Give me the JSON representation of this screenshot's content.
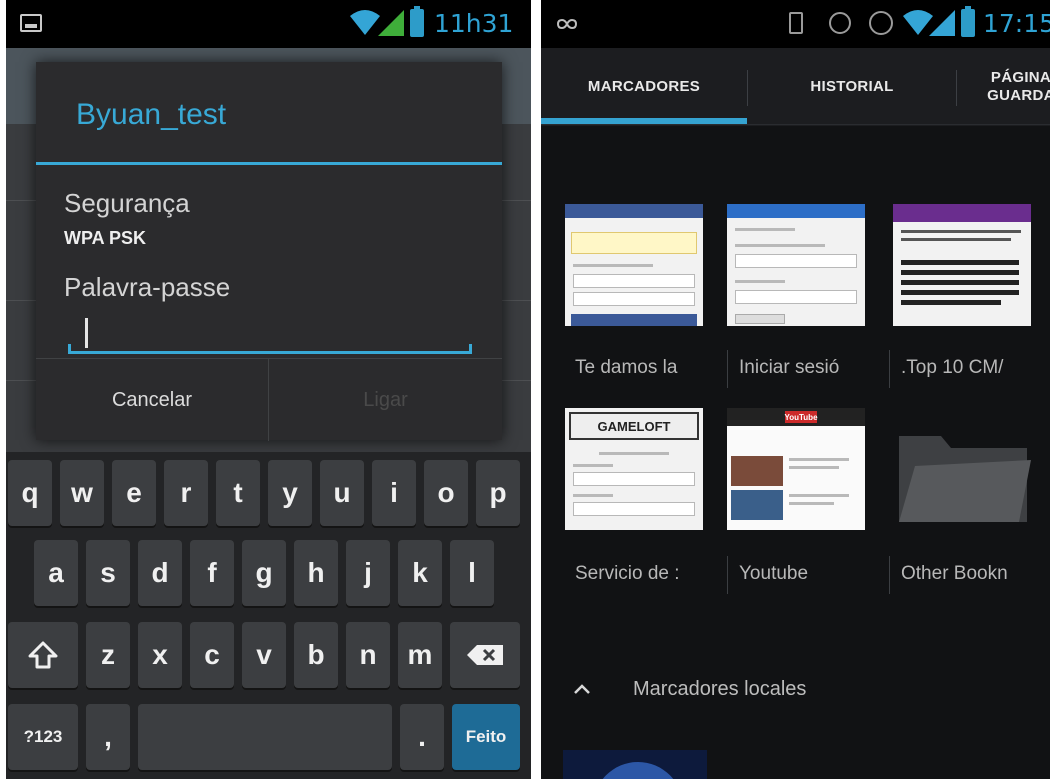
{
  "left_screen": {
    "status_bar": {
      "time": "11h31"
    },
    "dialog": {
      "network_name": "Byuan_test",
      "security_label": "Segurança",
      "security_value": "WPA PSK",
      "password_label": "Palavra-passe",
      "password_value": "",
      "cancel_label": "Cancelar",
      "connect_label": "Ligar"
    },
    "keyboard": {
      "row1": [
        "q",
        "w",
        "e",
        "r",
        "t",
        "y",
        "u",
        "i",
        "o",
        "p"
      ],
      "row2": [
        "a",
        "s",
        "d",
        "f",
        "g",
        "h",
        "j",
        "k",
        "l"
      ],
      "row3": [
        "z",
        "x",
        "c",
        "v",
        "b",
        "n",
        "m"
      ],
      "symbols_key": "?123",
      "comma_key": ",",
      "period_key": ".",
      "done_key": "Feito"
    }
  },
  "right_screen": {
    "status_bar": {
      "time": "17:15"
    },
    "tabs": [
      {
        "label": "MARCADORES",
        "active": true
      },
      {
        "label": "HISTORIAL",
        "active": false
      },
      {
        "label": "PÁGINA GUARDA",
        "active": false
      }
    ],
    "bookmarks": [
      {
        "label": "Te damos la",
        "thumb": "facebook"
      },
      {
        "label": "Iniciar sesió",
        "thumb": "hotmail"
      },
      {
        "label": ".Top 10 CM/",
        "thumb": "yahoo"
      },
      {
        "label": "Servicio de :",
        "thumb": "gameloft",
        "thumb_text": "GAMELOFT"
      },
      {
        "label": "Youtube",
        "thumb": "youtube",
        "thumb_text": "YouTube"
      },
      {
        "label": "Other Bookn",
        "thumb": "folder"
      }
    ],
    "local_section": {
      "title": "Marcadores locales"
    }
  },
  "colors": {
    "accent_blue": "#35a3d1",
    "dialog_bg": "#2b2b2d",
    "keyboard_bg": "#232426",
    "key_bg": "#3c3e41",
    "done_key_bg": "#1e6b96",
    "browser_bg": "#111214"
  },
  "icons": [
    "notification-icon",
    "wifi-icon",
    "signal-icon",
    "battery-icon",
    "infinity-icon",
    "vibrate-icon",
    "sync-icon",
    "alarm-icon",
    "shift-icon",
    "backspace-icon",
    "folder-icon",
    "chevron-up-icon"
  ]
}
